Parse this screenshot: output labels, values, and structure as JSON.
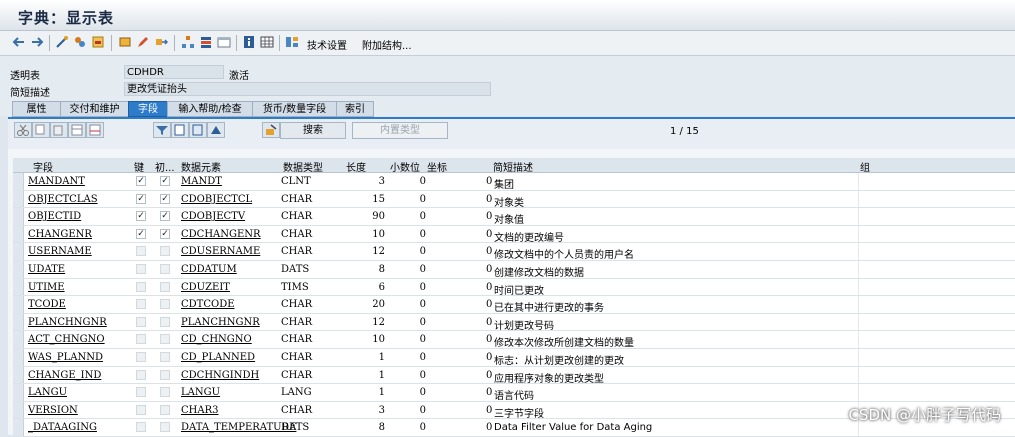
{
  "window": {
    "title": "字典：显示表"
  },
  "toolbar": {
    "tech_settings": "技术设置",
    "append_struct": "附加结构..."
  },
  "form": {
    "transparent_table_label": "透明表",
    "table_name": "CDHDR",
    "status": "激活",
    "short_desc_label": "简短描述",
    "short_desc": "更改凭证抬头"
  },
  "tabs": [
    "属性",
    "交付和维护",
    "字段",
    "输入帮助/检查",
    "货币/数量字段",
    "索引"
  ],
  "active_tab": "字段",
  "panel": {
    "search_button": "搜索",
    "builtin_type_button": "内置类型",
    "pager": "1  /  15"
  },
  "grid": {
    "headers": [
      "字段",
      "键",
      "初...",
      "数据元素",
      "数据类型",
      "长度",
      "小数位",
      "坐标",
      "简短描述",
      "组"
    ],
    "rows": [
      {
        "field": "MANDANT",
        "key": true,
        "init": true,
        "element": "MANDT",
        "type": "CLNT",
        "length": "3",
        "decimals": "0",
        "desc": "集团"
      },
      {
        "field": "OBJECTCLAS",
        "key": true,
        "init": true,
        "element": "CDOBJECTCL",
        "type": "CHAR",
        "length": "15",
        "decimals": "0",
        "desc": "对象类"
      },
      {
        "field": "OBJECTID",
        "key": true,
        "init": true,
        "element": "CDOBJECTV",
        "type": "CHAR",
        "length": "90",
        "decimals": "0",
        "desc": "对象值"
      },
      {
        "field": "CHANGENR",
        "key": true,
        "init": true,
        "element": "CDCHANGENR",
        "type": "CHAR",
        "length": "10",
        "decimals": "0",
        "desc": "文档的更改编号"
      },
      {
        "field": "USERNAME",
        "key": false,
        "init": false,
        "element": "CDUSERNAME",
        "type": "CHAR",
        "length": "12",
        "decimals": "0",
        "desc": "修改文档中的个人员责的用户名"
      },
      {
        "field": "UDATE",
        "key": false,
        "init": false,
        "element": "CDDATUM",
        "type": "DATS",
        "length": "8",
        "decimals": "0",
        "desc": "创建修改文档的数据"
      },
      {
        "field": "UTIME",
        "key": false,
        "init": false,
        "element": "CDUZEIT",
        "type": "TIMS",
        "length": "6",
        "decimals": "0",
        "desc": "时间已更改"
      },
      {
        "field": "TCODE",
        "key": false,
        "init": false,
        "element": "CDTCODE",
        "type": "CHAR",
        "length": "20",
        "decimals": "0",
        "desc": "已在其中进行更改的事务"
      },
      {
        "field": "PLANCHNGNR",
        "key": false,
        "init": false,
        "element": "PLANCHNGNR",
        "type": "CHAR",
        "length": "12",
        "decimals": "0",
        "desc": "计划更改号码"
      },
      {
        "field": "ACT_CHNGNO",
        "key": false,
        "init": false,
        "element": "CD_CHNGNO",
        "type": "CHAR",
        "length": "10",
        "decimals": "0",
        "desc": "修改本次修改所创建文档的数量"
      },
      {
        "field": "WAS_PLANND",
        "key": false,
        "init": false,
        "element": "CD_PLANNED",
        "type": "CHAR",
        "length": "1",
        "decimals": "0",
        "desc": "标志：从计划更改创建的更改"
      },
      {
        "field": "CHANGE_IND",
        "key": false,
        "init": false,
        "element": "CDCHNGINDH",
        "type": "CHAR",
        "length": "1",
        "decimals": "0",
        "desc": "应用程序对象的更改类型"
      },
      {
        "field": "LANGU",
        "key": false,
        "init": false,
        "element": "LANGU",
        "type": "LANG",
        "length": "1",
        "decimals": "0",
        "desc": "语言代码"
      },
      {
        "field": "VERSION",
        "key": false,
        "init": false,
        "element": "CHAR3",
        "type": "CHAR",
        "length": "3",
        "decimals": "0",
        "desc": "三字节字段"
      },
      {
        "field": "_DATAAGING",
        "key": false,
        "init": false,
        "element": "DATA_TEMPERATURE",
        "type": "DATS",
        "length": "8",
        "decimals": "0",
        "desc": "Data Filter Value for Data Aging"
      }
    ]
  },
  "watermark": "CSDN @小胖子写代码"
}
